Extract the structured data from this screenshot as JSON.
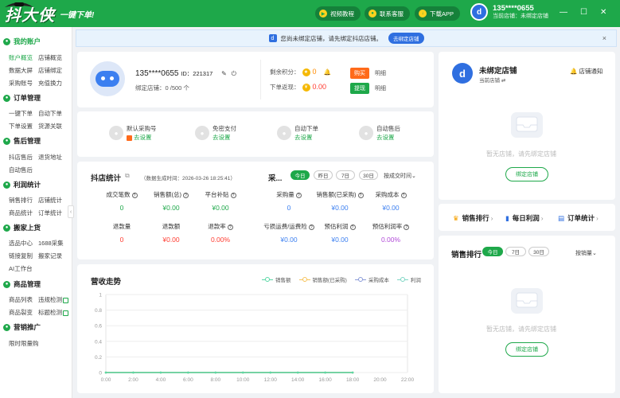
{
  "topbar": {
    "logo": "抖大侠",
    "logo_sub": "一键下单!",
    "btn_tutorial": "视频教程",
    "btn_service": "联系客服",
    "btn_download": "下载APP",
    "user_name": "135****0655",
    "user_sub": "当前店铺：未绑定店铺",
    "avatar_letter": "d",
    "win_min": "—",
    "win_max": "☐",
    "win_close": "✕"
  },
  "sidebar": {
    "sections": [
      {
        "label": "我的账户",
        "icon": "user-icon",
        "active": true,
        "items": [
          [
            "账户概览",
            "店铺概览"
          ],
          [
            "数据大屏",
            "店铺绑定"
          ],
          [
            "采购账号",
            "充值换力"
          ]
        ]
      },
      {
        "label": "订单管理",
        "icon": "order-icon",
        "items": [
          [
            "一键下单",
            "自动下单"
          ],
          [
            "下单设置",
            "货源关联"
          ]
        ]
      },
      {
        "label": "售后管理",
        "icon": "aftersale-icon",
        "items": [
          [
            "抖店售后",
            "退货地址"
          ],
          [
            "自动售后",
            ""
          ]
        ]
      },
      {
        "label": "利润统计",
        "icon": "profit-icon",
        "items": [
          [
            "销售排行",
            "店铺统计"
          ],
          [
            "商品统计",
            "订单统计"
          ]
        ]
      },
      {
        "label": "搬家上货",
        "icon": "move-icon",
        "items": [
          [
            "选品中心",
            "1688采集"
          ],
          [
            "链接复制",
            "搬家记录"
          ],
          [
            "AI工作台",
            ""
          ]
        ]
      },
      {
        "label": "商品管理",
        "icon": "goods-icon",
        "items": [
          [
            "商品列表",
            "违规检测"
          ],
          [
            "商品裂变",
            "标题检测"
          ]
        ]
      },
      {
        "label": "营销推广",
        "icon": "promo-icon",
        "items": [
          [
            "限时限量购",
            ""
          ]
        ]
      }
    ],
    "collapse": "‹"
  },
  "notice": {
    "text": "您尚未绑定店铺，请先绑定抖店店铺。",
    "button": "去绑定店铺",
    "close": "×"
  },
  "account": {
    "phone": "135****0655",
    "id_label": "ID：",
    "id_value": "221317",
    "shop_bind_label": "绑定店铺：",
    "shop_bind_value": "0 /500 个",
    "points_label": "剩余积分：",
    "points_value": "0",
    "rebate_label": "下单返现：",
    "rebate_value": "0.00",
    "buy": "购买",
    "detail1": "明细",
    "withdraw": "提现",
    "detail2": "明细"
  },
  "features": [
    {
      "title": "默认采购号",
      "link": "去设置"
    },
    {
      "title": "免密支付",
      "link": "去设置"
    },
    {
      "title": "自动下单",
      "link": "去设置"
    },
    {
      "title": "自动售后",
      "link": "去设置"
    }
  ],
  "stats": {
    "title": "抖店统计",
    "note": "（数据生成时间：2026-03-26 18:25:41）",
    "purchase_title": "采...",
    "filters": [
      "今日",
      "昨日",
      "7日",
      "30日"
    ],
    "range": "按成交时间⌄",
    "left": [
      {
        "label": "成交笔数",
        "value": "0",
        "color": "g"
      },
      {
        "label": "销售额(总)",
        "value": "¥0.00",
        "color": "g"
      },
      {
        "label": "平台补贴",
        "value": "¥0.00",
        "color": "g"
      },
      {
        "label": "退款量",
        "value": "0",
        "color": "r"
      },
      {
        "label": "退款额",
        "value": "¥0.00",
        "color": "r"
      },
      {
        "label": "退款率",
        "value": "0.00%",
        "color": "r"
      }
    ],
    "right": [
      {
        "label": "采购量",
        "value": "0",
        "color": "b"
      },
      {
        "label": "销售额(已采购)",
        "value": "¥0.00",
        "color": "b"
      },
      {
        "label": "采购成本",
        "value": "¥0.00",
        "color": "b"
      },
      {
        "label": "亏损运费/运费险",
        "value": "¥0.00",
        "color": "b"
      },
      {
        "label": "预估利润",
        "value": "¥0.00",
        "color": "b"
      },
      {
        "label": "预估利润率",
        "value": "0.00%",
        "color": "p"
      }
    ]
  },
  "revenue": {
    "title": "营收走势"
  },
  "chart_data": {
    "type": "line",
    "x": [
      "0:00",
      "2:00",
      "4:00",
      "6:00",
      "8:00",
      "10:00",
      "12:00",
      "14:00",
      "16:00",
      "18:00",
      "20:00",
      "22:00"
    ],
    "series": [
      {
        "name": "销售额",
        "values": [
          0,
          0,
          0,
          0,
          0,
          0,
          0,
          0,
          0,
          0
        ],
        "color": "#5ad8a6"
      },
      {
        "name": "销售额(已采购)",
        "values": [
          0,
          0,
          0,
          0,
          0,
          0,
          0,
          0,
          0,
          0
        ],
        "color": "#f6c35a"
      },
      {
        "name": "采购成本",
        "values": [
          0,
          0,
          0,
          0,
          0,
          0,
          0,
          0,
          0,
          0
        ],
        "color": "#8a9bd8"
      },
      {
        "name": "利润",
        "values": [
          0,
          0,
          0,
          0,
          0,
          0,
          0,
          0,
          0,
          0
        ],
        "color": "#7dd6c4"
      }
    ],
    "y_ticks": [
      "1",
      "0.8",
      "0.6",
      "0.4",
      "0.2",
      "0"
    ],
    "ylim": [
      0,
      1
    ],
    "grid": true,
    "legend": "top-right"
  },
  "shop_panel": {
    "name": "未绑定店铺",
    "sub": "当前店铺",
    "notify": "店铺通知",
    "empty": "暂无店铺，请先绑定店铺",
    "bind": "绑定店铺"
  },
  "ranks": [
    {
      "label": "销售排行",
      "icon": "medal-icon"
    },
    {
      "label": "每日利润",
      "icon": "bar-chart-icon"
    },
    {
      "label": "订单统计",
      "icon": "order-stat-icon"
    }
  ],
  "sales_rank": {
    "title": "销售排行",
    "filters": [
      "今日",
      "7日",
      "30日"
    ],
    "sort": "按销量⌄",
    "empty": "暂无店铺，请先绑定店铺",
    "bind": "绑定店铺"
  },
  "colors": {
    "brand": "#1ea84a",
    "blue": "#2f6fe0",
    "red": "#ff3b30"
  }
}
